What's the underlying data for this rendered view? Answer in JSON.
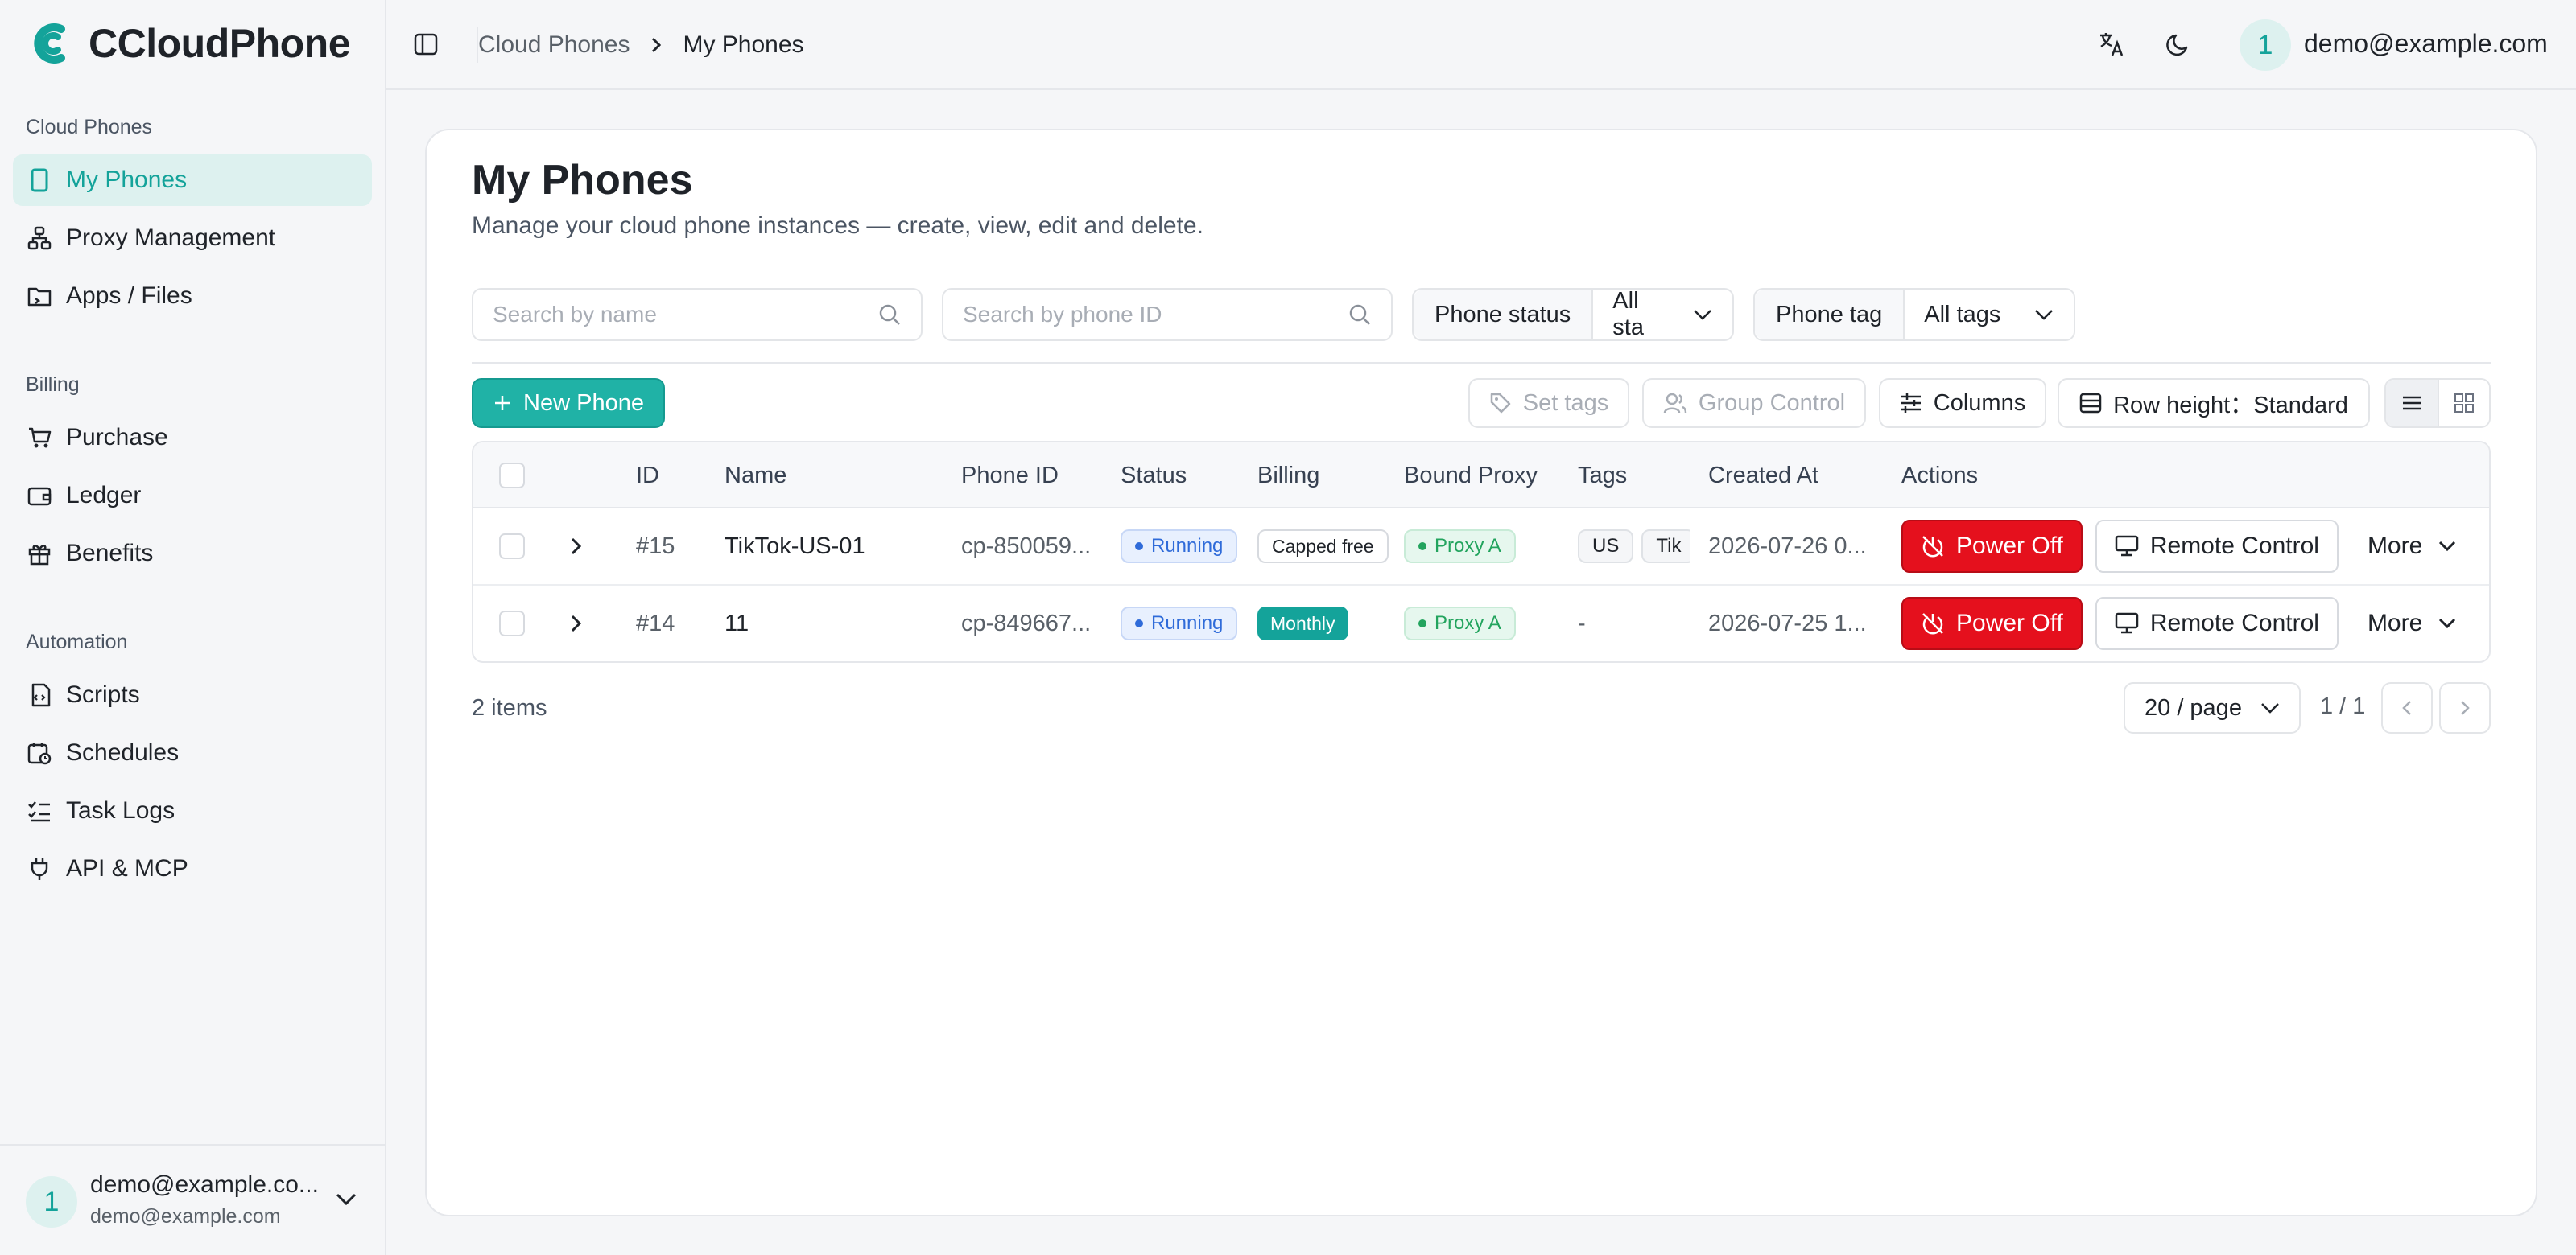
{
  "app": {
    "name": "CCloudPhone"
  },
  "sidebar": {
    "sections": [
      {
        "label": "Cloud Phones"
      },
      {
        "label": "Billing"
      },
      {
        "label": "Automation"
      }
    ],
    "items": [
      {
        "label": "My Phones",
        "icon": "phone-icon",
        "active": true
      },
      {
        "label": "Proxy Management",
        "icon": "network-icon"
      },
      {
        "label": "Apps / Files",
        "icon": "folder-icon"
      },
      {
        "label": "Purchase",
        "icon": "cart-icon"
      },
      {
        "label": "Ledger",
        "icon": "wallet-icon"
      },
      {
        "label": "Benefits",
        "icon": "gift-icon"
      },
      {
        "label": "Scripts",
        "icon": "script-icon"
      },
      {
        "label": "Schedules",
        "icon": "calendar-clock-icon"
      },
      {
        "label": "Task Logs",
        "icon": "list-checks-icon"
      },
      {
        "label": "API & MCP",
        "icon": "plug-icon"
      }
    ],
    "user": {
      "avatar": "1",
      "name": "demo@example.co...",
      "email": "demo@example.com"
    }
  },
  "header": {
    "breadcrumb": [
      "Cloud Phones",
      "My Phones"
    ],
    "user": {
      "avatar": "1",
      "email": "demo@example.com"
    }
  },
  "page": {
    "title": "My Phones",
    "subtitle": "Manage your cloud phone instances — create, view, edit and delete."
  },
  "filters": {
    "search_name_placeholder": "Search by name",
    "search_id_placeholder": "Search by phone ID",
    "status_label": "Phone status",
    "status_value": "All sta",
    "tag_label": "Phone tag",
    "tag_value": "All tags"
  },
  "toolbar": {
    "new_phone": "New Phone",
    "set_tags": "Set tags",
    "group_control": "Group Control",
    "columns": "Columns",
    "row_height": "Row height：Standard"
  },
  "table": {
    "columns": [
      "ID",
      "Name",
      "Phone ID",
      "Status",
      "Billing",
      "Bound Proxy",
      "Tags",
      "Created At",
      "Actions"
    ],
    "rows": [
      {
        "id": "#15",
        "name": "TikTok-US-01",
        "phone_id": "cp-850059...",
        "status": "Running",
        "billing": "Capped free",
        "proxy": "Proxy A",
        "tags": [
          "US",
          "Tik"
        ],
        "created_at": "2026-07-26 0...",
        "power_off": "Power Off",
        "remote": "Remote Control",
        "more": "More"
      },
      {
        "id": "#14",
        "name": "11",
        "phone_id": "cp-849667...",
        "status": "Running",
        "billing": "Monthly",
        "proxy": "Proxy A",
        "tags_text": "-",
        "created_at": "2026-07-25 1...",
        "power_off": "Power Off",
        "remote": "Remote Control",
        "more": "More"
      }
    ]
  },
  "footer": {
    "items_count": "2 items",
    "page_size": "20 / page",
    "page_indicator": "1 / 1"
  },
  "colors": {
    "accent": "#14a39a",
    "danger": "#e5101d",
    "running": "#2f6bd9",
    "proxy": "#23a45e"
  }
}
